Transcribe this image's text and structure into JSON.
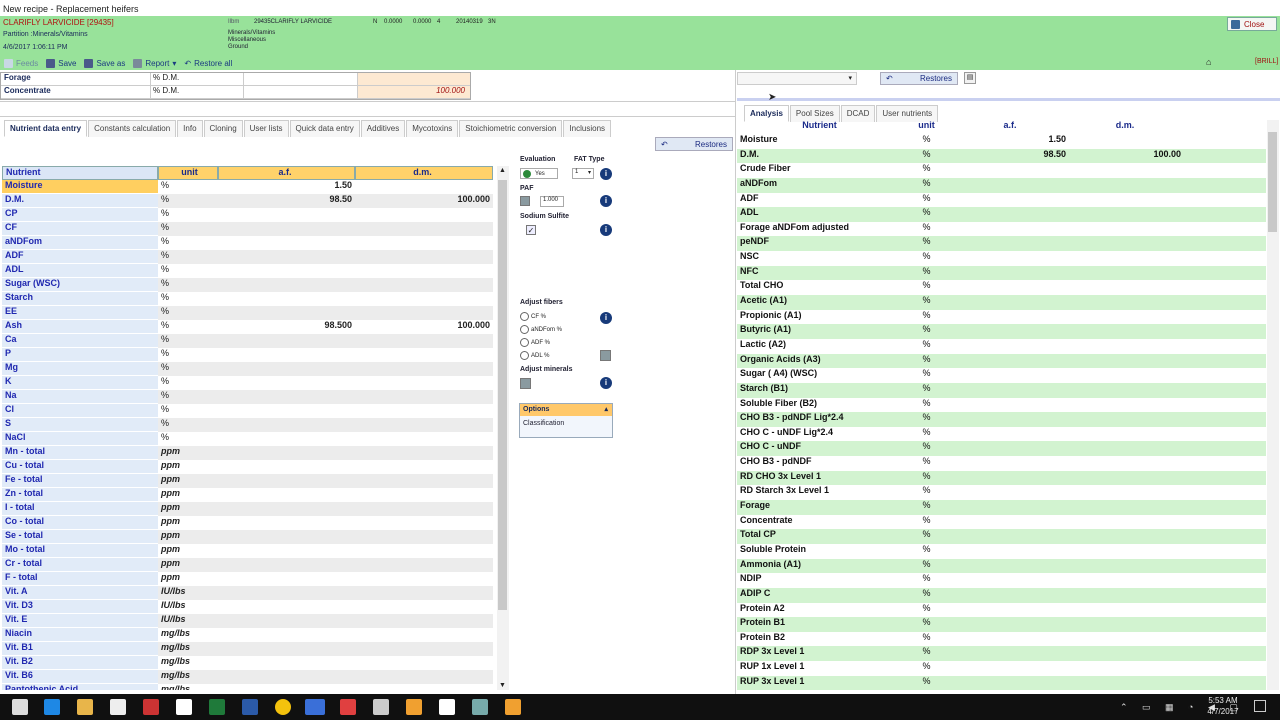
{
  "window": {
    "title": "New recipe - Replacement heifers",
    "close_label": "Close",
    "brill": "[BRILL]"
  },
  "header": {
    "feed_name": "CLARIFLY LARVICIDE [29435]",
    "partition": "Partition :Minerals/Vitamins",
    "datetime": "4/6/2017 1:06:11 PM",
    "unit": "Ilbm",
    "code_name": "29435CLARIFLY LARVICIDE",
    "n": "N",
    "v1": "0.0000",
    "v2": "0.0000",
    "v3": "4",
    "date_code": "20140319",
    "code": "3N",
    "class_lines": [
      "Minerals/Vitamins",
      "Miscellaneous",
      "Ground"
    ]
  },
  "toolbar": {
    "feeds": "Feeds",
    "save": "Save",
    "save_as": "Save as",
    "report": "Report",
    "restore_all": "Restore all"
  },
  "forage_box": {
    "rows": [
      {
        "label": "Forage",
        "unit": "% D.M.",
        "value": ""
      },
      {
        "label": "Concentrate",
        "unit": "% D.M.",
        "value": "100.000"
      }
    ]
  },
  "left_tabs": [
    "Nutrient data entry",
    "Constants calculation",
    "Info",
    "Cloning",
    "User lists",
    "Quick data entry",
    "Additives",
    "Mycotoxins",
    "Stoichiometric conversion",
    "Inclusions"
  ],
  "restores_label": "Restores",
  "left_table": {
    "headers": [
      "Nutrient",
      "unit",
      "a.f.",
      "d.m."
    ],
    "rows": [
      {
        "n": "Moisture",
        "u": "%",
        "af": "1.50",
        "dm": ""
      },
      {
        "n": "D.M.",
        "u": "%",
        "af": "98.50",
        "dm": "100.000"
      },
      {
        "n": "CP",
        "u": "%",
        "af": "",
        "dm": ""
      },
      {
        "n": "CF",
        "u": "%",
        "af": "",
        "dm": ""
      },
      {
        "n": "aNDFom",
        "u": "%",
        "af": "",
        "dm": ""
      },
      {
        "n": "ADF",
        "u": "%",
        "af": "",
        "dm": ""
      },
      {
        "n": "ADL",
        "u": "%",
        "af": "",
        "dm": ""
      },
      {
        "n": "Sugar (WSC)",
        "u": "%",
        "af": "",
        "dm": ""
      },
      {
        "n": "Starch",
        "u": "%",
        "af": "",
        "dm": ""
      },
      {
        "n": "EE",
        "u": "%",
        "af": "",
        "dm": ""
      },
      {
        "n": "Ash",
        "u": "%",
        "af": "98.500",
        "dm": "100.000"
      },
      {
        "n": "Ca",
        "u": "%",
        "af": "",
        "dm": ""
      },
      {
        "n": "P",
        "u": "%",
        "af": "",
        "dm": ""
      },
      {
        "n": "Mg",
        "u": "%",
        "af": "",
        "dm": ""
      },
      {
        "n": "K",
        "u": "%",
        "af": "",
        "dm": ""
      },
      {
        "n": "Na",
        "u": "%",
        "af": "",
        "dm": ""
      },
      {
        "n": "Cl",
        "u": "%",
        "af": "",
        "dm": ""
      },
      {
        "n": "S",
        "u": "%",
        "af": "",
        "dm": ""
      },
      {
        "n": "NaCl",
        "u": "%",
        "af": "",
        "dm": ""
      },
      {
        "n": "Mn - total",
        "u": "ppm",
        "af": "",
        "dm": ""
      },
      {
        "n": "Cu - total",
        "u": "ppm",
        "af": "",
        "dm": ""
      },
      {
        "n": "Fe - total",
        "u": "ppm",
        "af": "",
        "dm": ""
      },
      {
        "n": "Zn - total",
        "u": "ppm",
        "af": "",
        "dm": ""
      },
      {
        "n": "I - total",
        "u": "ppm",
        "af": "",
        "dm": ""
      },
      {
        "n": "Co - total",
        "u": "ppm",
        "af": "",
        "dm": ""
      },
      {
        "n": "Se - total",
        "u": "ppm",
        "af": "",
        "dm": ""
      },
      {
        "n": "Mo - total",
        "u": "ppm",
        "af": "",
        "dm": ""
      },
      {
        "n": "Cr - total",
        "u": "ppm",
        "af": "",
        "dm": ""
      },
      {
        "n": "F - total",
        "u": "ppm",
        "af": "",
        "dm": ""
      },
      {
        "n": "Vit. A",
        "u": "IU/lbs",
        "af": "",
        "dm": ""
      },
      {
        "n": "Vit. D3",
        "u": "IU/lbs",
        "af": "",
        "dm": ""
      },
      {
        "n": "Vit. E",
        "u": "IU/lbs",
        "af": "",
        "dm": ""
      },
      {
        "n": "Niacin",
        "u": "mg/lbs",
        "af": "",
        "dm": ""
      },
      {
        "n": "Vit. B1",
        "u": "mg/lbs",
        "af": "",
        "dm": ""
      },
      {
        "n": "Vit. B2",
        "u": "mg/lbs",
        "af": "",
        "dm": ""
      },
      {
        "n": "Vit. B6",
        "u": "mg/lbs",
        "af": "",
        "dm": ""
      },
      {
        "n": "Pantothenic Acid",
        "u": "mg/lbs",
        "af": "",
        "dm": ""
      }
    ]
  },
  "mid": {
    "evaluation": "Evaluation",
    "yes": "Yes",
    "fat_type": "FAT Type",
    "fat_value": "1",
    "paf": "PAF",
    "paf_value": "1.000",
    "sodium_sulfite": "Sodium Sulfite",
    "adjust_fibers": "Adjust fibers",
    "fibers": [
      "CF %",
      "aNDFom %",
      "ADF %",
      "ADL %"
    ],
    "adjust_minerals": "Adjust minerals",
    "options": "Options",
    "classification": "Classification",
    "info": "i"
  },
  "right_tabs": [
    "Analysis",
    "Pool Sizes",
    "DCAD",
    "User nutrients"
  ],
  "right_table": {
    "headers": [
      "Nutrient",
      "unit",
      "a.f.",
      "d.m."
    ],
    "rows": [
      {
        "n": "Moisture",
        "u": "%",
        "af": "1.50",
        "dm": ""
      },
      {
        "n": "D.M.",
        "u": "%",
        "af": "98.50",
        "dm": "100.00"
      },
      {
        "n": "Crude Fiber",
        "u": "%",
        "af": "",
        "dm": ""
      },
      {
        "n": "aNDFom",
        "u": "%",
        "af": "",
        "dm": ""
      },
      {
        "n": "ADF",
        "u": "%",
        "af": "",
        "dm": ""
      },
      {
        "n": "ADL",
        "u": "%",
        "af": "",
        "dm": ""
      },
      {
        "n": "Forage aNDFom adjusted",
        "u": "%",
        "af": "",
        "dm": ""
      },
      {
        "n": "peNDF",
        "u": "%",
        "af": "",
        "dm": ""
      },
      {
        "n": "NSC",
        "u": "%",
        "af": "",
        "dm": ""
      },
      {
        "n": "NFC",
        "u": "%",
        "af": "",
        "dm": ""
      },
      {
        "n": "Total CHO",
        "u": "%",
        "af": "",
        "dm": ""
      },
      {
        "n": "Acetic (A1)",
        "u": "%",
        "af": "",
        "dm": ""
      },
      {
        "n": "Propionic (A1)",
        "u": "%",
        "af": "",
        "dm": ""
      },
      {
        "n": "Butyric (A1)",
        "u": "%",
        "af": "",
        "dm": ""
      },
      {
        "n": "Lactic (A2)",
        "u": "%",
        "af": "",
        "dm": ""
      },
      {
        "n": "Organic Acids (A3)",
        "u": "%",
        "af": "",
        "dm": ""
      },
      {
        "n": "Sugar ( A4) (WSC)",
        "u": "%",
        "af": "",
        "dm": ""
      },
      {
        "n": "Starch (B1)",
        "u": "%",
        "af": "",
        "dm": ""
      },
      {
        "n": "Soluble Fiber (B2)",
        "u": "%",
        "af": "",
        "dm": ""
      },
      {
        "n": "CHO B3 - pdNDF Lig*2.4",
        "u": "%",
        "af": "",
        "dm": ""
      },
      {
        "n": "CHO C - uNDF Lig*2.4",
        "u": "%",
        "af": "",
        "dm": ""
      },
      {
        "n": "CHO C - uNDF",
        "u": "%",
        "af": "",
        "dm": ""
      },
      {
        "n": "CHO B3 - pdNDF",
        "u": "%",
        "af": "",
        "dm": ""
      },
      {
        "n": "RD CHO 3x Level 1",
        "u": "%",
        "af": "",
        "dm": ""
      },
      {
        "n": "RD Starch 3x Level 1",
        "u": "%",
        "af": "",
        "dm": ""
      },
      {
        "n": "Forage",
        "u": "%",
        "af": "",
        "dm": ""
      },
      {
        "n": "Concentrate",
        "u": "%",
        "af": "",
        "dm": ""
      },
      {
        "n": "Total CP",
        "u": "%",
        "af": "",
        "dm": ""
      },
      {
        "n": "Soluble Protein",
        "u": "%",
        "af": "",
        "dm": ""
      },
      {
        "n": "Ammonia (A1)",
        "u": "%",
        "af": "",
        "dm": ""
      },
      {
        "n": "NDIP",
        "u": "%",
        "af": "",
        "dm": ""
      },
      {
        "n": "ADIP  C",
        "u": "%",
        "af": "",
        "dm": ""
      },
      {
        "n": "Protein A2",
        "u": "%",
        "af": "",
        "dm": ""
      },
      {
        "n": "Protein B1",
        "u": "%",
        "af": "",
        "dm": ""
      },
      {
        "n": "Protein B2",
        "u": "%",
        "af": "",
        "dm": ""
      },
      {
        "n": "RDP 3x Level 1",
        "u": "%",
        "af": "",
        "dm": ""
      },
      {
        "n": "RUP 1x Level 1",
        "u": "%",
        "af": "",
        "dm": ""
      },
      {
        "n": "RUP 3x Level 1",
        "u": "%",
        "af": "",
        "dm": ""
      }
    ]
  },
  "taskbar": {
    "time": "5:53 AM",
    "date": "4/7/2017"
  }
}
